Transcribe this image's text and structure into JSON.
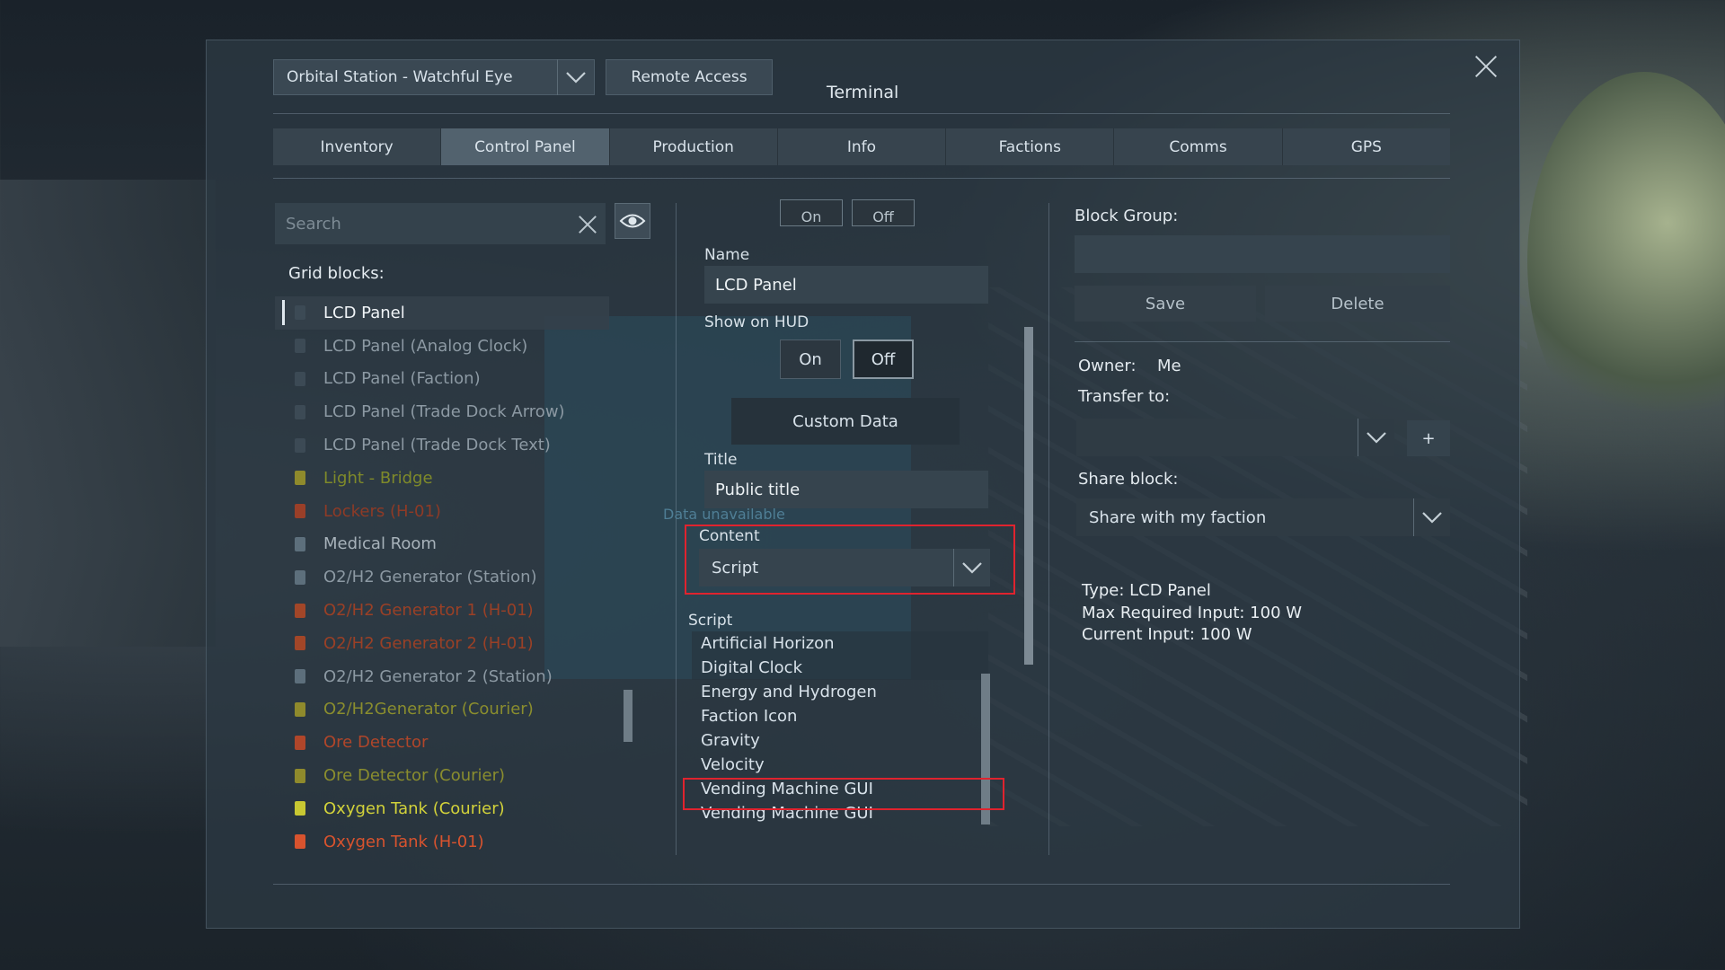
{
  "window": {
    "grid_selector": "Orbital Station - Watchful Eye",
    "remote_access": "Remote Access",
    "title": "Terminal"
  },
  "tabs": [
    {
      "label": "Inventory"
    },
    {
      "label": "Control Panel",
      "active": true
    },
    {
      "label": "Production"
    },
    {
      "label": "Info"
    },
    {
      "label": "Factions"
    },
    {
      "label": "Comms"
    },
    {
      "label": "GPS"
    }
  ],
  "left": {
    "search_placeholder": "Search",
    "grid_blocks_label": "Grid blocks:",
    "blocks": [
      {
        "label": "LCD Panel",
        "color": "#f0f4f7",
        "icon_color": "#3c4a55",
        "selected": true
      },
      {
        "label": "LCD Panel (Analog Clock)",
        "color": "#8c99a3",
        "icon_color": "#3c4a55"
      },
      {
        "label": "LCD Panel (Faction)",
        "color": "#8c99a3",
        "icon_color": "#3c4a55"
      },
      {
        "label": "LCD Panel (Trade Dock Arrow)",
        "color": "#8c99a3",
        "icon_color": "#3c4a55"
      },
      {
        "label": "LCD Panel (Trade Dock Text)",
        "color": "#8c99a3",
        "icon_color": "#3c4a55"
      },
      {
        "label": "Light - Bridge",
        "color": "#7f8a2a",
        "icon_color": "#8f8a2c"
      },
      {
        "label": "Lockers (H-01)",
        "color": "#8e3a26",
        "icon_color": "#9a3f28"
      },
      {
        "label": "Medical Room",
        "color": "#a7b2ba",
        "icon_color": "#5d6f7c"
      },
      {
        "label": "O2/H2 Generator (Station)",
        "color": "#8c99a3",
        "icon_color": "#5d6f7c"
      },
      {
        "label": "O2/H2 Generator 1 (H-01)",
        "color": "#9a4026",
        "icon_color": "#a24628"
      },
      {
        "label": "O2/H2 Generator 2 (H-01)",
        "color": "#9a4026",
        "icon_color": "#a24628"
      },
      {
        "label": "O2/H2 Generator 2 (Station)",
        "color": "#8c99a3",
        "icon_color": "#5d6f7c"
      },
      {
        "label": "O2/H2Generator (Courier)",
        "color": "#8a8d2e",
        "icon_color": "#8f8a2c"
      },
      {
        "label": "Ore Detector",
        "color": "#b0462a",
        "icon_color": "#b0462a"
      },
      {
        "label": "Ore Detector (Courier)",
        "color": "#8a8d2e",
        "icon_color": "#8f8a2c"
      },
      {
        "label": "Oxygen Tank (Courier)",
        "color": "#d2d23a",
        "icon_color": "#c8c832"
      },
      {
        "label": "Oxygen Tank (H-01)",
        "color": "#d8532e",
        "icon_color": "#d8532e"
      }
    ]
  },
  "middle": {
    "top_on": "On",
    "top_off": "Off",
    "name_label": "Name",
    "name_value": "LCD Panel",
    "show_on_hud_label": "Show on HUD",
    "on_label": "On",
    "off_label": "Off",
    "custom_data": "Custom Data",
    "title_label": "Title",
    "title_value": "Public title",
    "data_unavailable": "Data unavailable",
    "content_label": "Content",
    "content_value": "Script",
    "script_label": "Script",
    "scripts": [
      {
        "label": "Artificial Horizon",
        "highlight": true
      },
      {
        "label": "Digital Clock",
        "highlight": true
      },
      {
        "label": "Energy and Hydrogen"
      },
      {
        "label": "Faction Icon"
      },
      {
        "label": "Gravity"
      },
      {
        "label": "Velocity"
      },
      {
        "label": "Vending Machine GUI",
        "selected": true
      },
      {
        "label": "Vending Machine GUI"
      }
    ]
  },
  "right": {
    "block_group_label": "Block Group:",
    "save": "Save",
    "delete": "Delete",
    "owner_label": "Owner:",
    "owner_value": "Me",
    "transfer_label": "Transfer to:",
    "plus": "+",
    "share_label": "Share block:",
    "share_value": "Share with my faction",
    "type_line": "Type: LCD Panel",
    "max_input_line": "Max Required Input: 100 W",
    "current_input_line": "Current Input: 100 W"
  },
  "colors": {
    "highlight_red": "#e0232e",
    "panel_bg": "#2c3842"
  }
}
